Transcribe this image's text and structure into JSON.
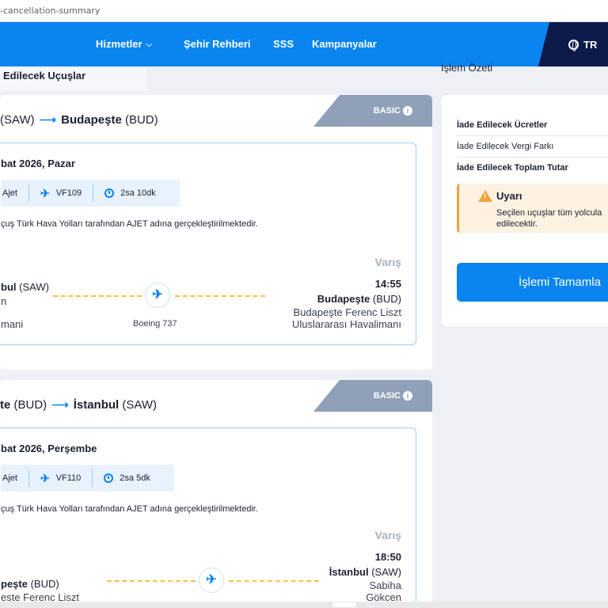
{
  "browser": {
    "url": "-cancellation-summary"
  },
  "nav": {
    "items": [
      "Hizmetler",
      "Şehir Rehberi",
      "SSS",
      "Kampanyalar"
    ],
    "dropdown_chevron": "chevron-down-icon",
    "language": "TR"
  },
  "section_title": "Edilecek Uçuşlar",
  "summary_title": "İşlem Özeti",
  "flights": [
    {
      "badge": "BASIC",
      "route_from_code": "(SAW)",
      "route_to_city": "Budapeşte",
      "route_to_code": "(BUD)",
      "date": "bat 2026, Pazar",
      "carrier": "Ajet",
      "flight_no": "VF109",
      "duration": "2sa 10dk",
      "operated_by": "çuş Türk Hava Yolları tarafından AJET adına gerçekleştirilmektedir.",
      "arrival_label": "Varış",
      "arrival_time": "14:55",
      "dep_city_name": "bul",
      "dep_city_code": "(SAW)",
      "dep_airport_1": "n",
      "dep_airport_2": "mani",
      "arr_city_name": "Budapeşte",
      "arr_city_code": "(BUD)",
      "arr_airport_1": "Budapeşte Ferenc Liszt",
      "arr_airport_2": "Uluslararası Havalimanı",
      "aircraft": "Boeing 737"
    },
    {
      "badge": "BASIC",
      "route_from_city": "te",
      "route_from_code": "(BUD)",
      "route_to_city": "İstanbul",
      "route_to_code": "(SAW)",
      "date": "bat 2026, Perşembe",
      "carrier": "Ajet",
      "flight_no": "VF110",
      "duration": "2sa 5dk",
      "operated_by": "çuş Türk Hava Yolları tarafından AJET adına gerçekleştirilmektedir.",
      "arrival_label": "Varış",
      "arrival_time": "18:50",
      "dep_city_name": "peşte",
      "dep_city_code": "(BUD)",
      "dep_airport_1": "este Ferenc Liszt",
      "arr_city_name": "İstanbul",
      "arr_city_code": "(SAW)",
      "arr_airport_1": "Sabiha",
      "arr_airport_2": "Gökcen"
    }
  ],
  "summary": {
    "refund_fees": "İade Edilecek Ücretler",
    "refund_tax": "İade Edilecek Vergi Farkı",
    "refund_total": "İade Edilecek Toplam Tutar",
    "warning_title": "Uyarı",
    "warning_line1": "Seçilen uçuşlar tüm yolcula",
    "warning_line2": "edilecektir.",
    "complete_button": "İşlemi Tamamla"
  },
  "colors": {
    "brand_blue": "#0a84ef",
    "navy": "#0d1b4b",
    "warning": "#f0a43a"
  }
}
